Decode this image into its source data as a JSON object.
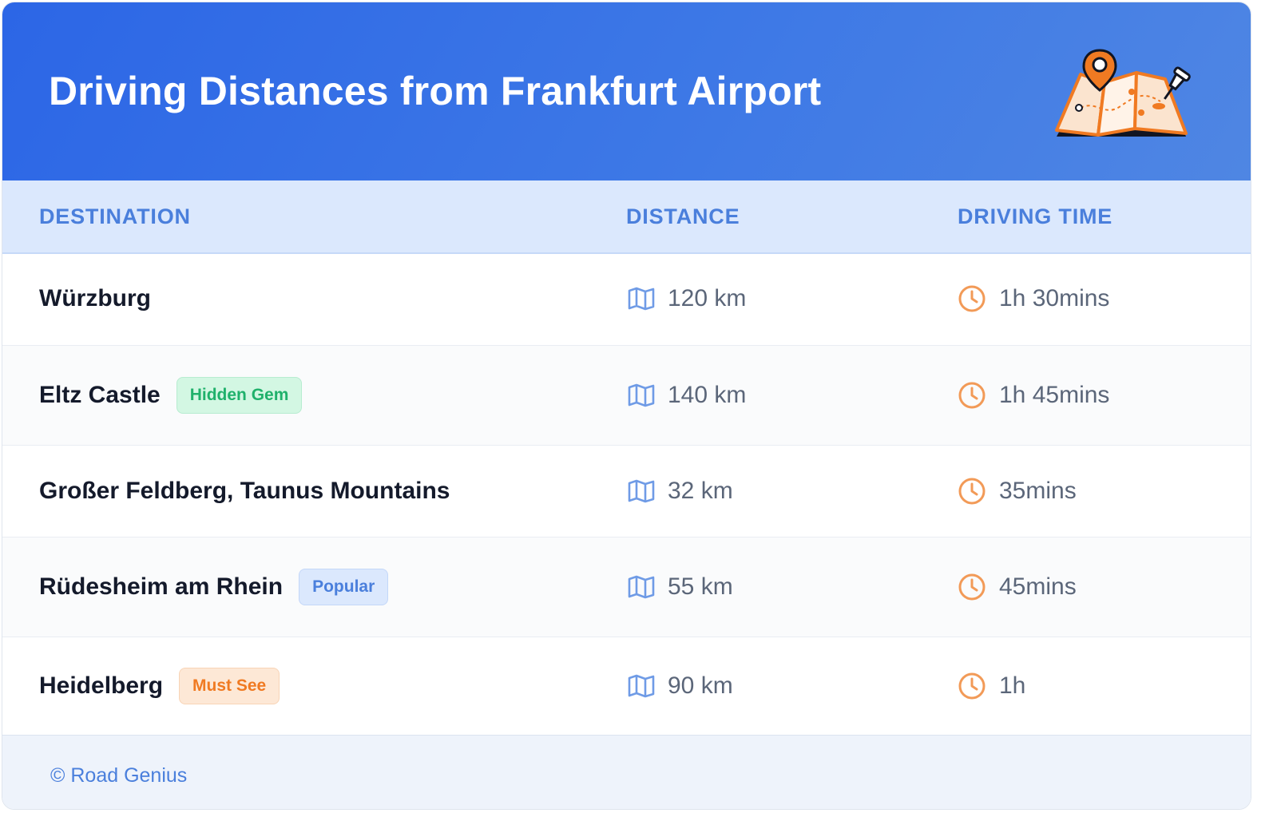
{
  "header": {
    "title": "Driving Distances from Frankfurt Airport",
    "illustration": "map-with-pins-icon",
    "gradient_colors": [
      "#2c66e6",
      "#4f86e3"
    ]
  },
  "table": {
    "columns": [
      "DESTINATION",
      "DISTANCE",
      "DRIVING TIME"
    ],
    "rows": [
      {
        "destination": "Würzburg",
        "badge": "",
        "badge_style": "",
        "distance": "120 km",
        "time": "1h 30mins"
      },
      {
        "destination": "Eltz Castle",
        "badge": "Hidden Gem",
        "badge_style": "green",
        "distance": "140 km",
        "time": "1h 45mins"
      },
      {
        "destination": "Großer Feldberg, Taunus Mountains",
        "badge": "",
        "badge_style": "",
        "distance": "32 km",
        "time": "35mins"
      },
      {
        "destination": "Rüdesheim am Rhein",
        "badge": "Popular",
        "badge_style": "blue",
        "distance": "55 km",
        "time": "45mins"
      },
      {
        "destination": "Heidelberg",
        "badge": "Must See",
        "badge_style": "orange",
        "distance": "90 km",
        "time": "1h"
      }
    ],
    "distance_icon": "map-icon",
    "time_icon": "clock-icon"
  },
  "footer": {
    "text": "© Road Genius"
  },
  "colors": {
    "accent": "#4a7fdc",
    "title_text": "#ffffff",
    "badge_green": "#1fb16b",
    "badge_blue": "#4a7fdc",
    "badge_orange": "#f07a22"
  }
}
